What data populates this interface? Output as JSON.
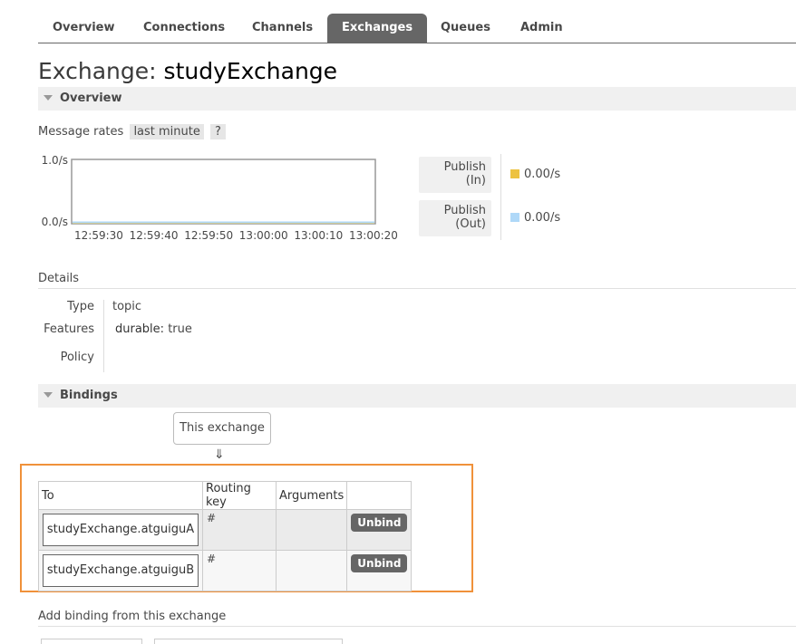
{
  "nav": {
    "tabs": [
      {
        "label": "Overview",
        "active": false
      },
      {
        "label": "Connections",
        "active": false
      },
      {
        "label": "Channels",
        "active": false
      },
      {
        "label": "Exchanges",
        "active": true
      },
      {
        "label": "Queues",
        "active": false
      },
      {
        "label": "Admin",
        "active": false
      }
    ]
  },
  "page": {
    "title_prefix": "Exchange:",
    "title_name": "studyExchange"
  },
  "overview": {
    "header": "Overview",
    "message_rates_label": "Message rates",
    "range": "last minute",
    "help": "?",
    "publish_in_label_1": "Publish",
    "publish_in_label_2": "(In)",
    "publish_out_label_1": "Publish",
    "publish_out_label_2": "(Out)",
    "publish_in_value": "0.00/s",
    "publish_out_value": "0.00/s"
  },
  "chart_data": {
    "type": "line",
    "title": "",
    "xlabel": "",
    "ylabel": "",
    "ylim": [
      0,
      1
    ],
    "y_tick_labels": [
      "1.0/s",
      "0.0/s"
    ],
    "x": [
      "12:59:30",
      "12:59:40",
      "12:59:50",
      "13:00:00",
      "13:00:10",
      "13:00:20"
    ],
    "series": [
      {
        "name": "Publish (In)",
        "color": "#edc240",
        "values": [
          0,
          0,
          0,
          0,
          0,
          0
        ]
      },
      {
        "name": "Publish (Out)",
        "color": "#afd8f8",
        "values": [
          0,
          0,
          0,
          0,
          0,
          0
        ]
      }
    ]
  },
  "details": {
    "title": "Details",
    "type_label": "Type",
    "type_value": "topic",
    "features_label": "Features",
    "features_key": "durable:",
    "features_value": "true",
    "policy_label": "Policy",
    "policy_value": ""
  },
  "bindings": {
    "header": "Bindings",
    "this_exchange": "This exchange",
    "arrow": "⇓",
    "columns": [
      "To",
      "Routing key",
      "Arguments",
      ""
    ],
    "rows": [
      {
        "to": "studyExchange.atguiguA",
        "routing_key": "#",
        "arguments": "",
        "action": "Unbind"
      },
      {
        "to": "studyExchange.atguiguB",
        "routing_key": "#",
        "arguments": "",
        "action": "Unbind"
      }
    ]
  },
  "add_binding": {
    "title": "Add binding from this exchange"
  }
}
